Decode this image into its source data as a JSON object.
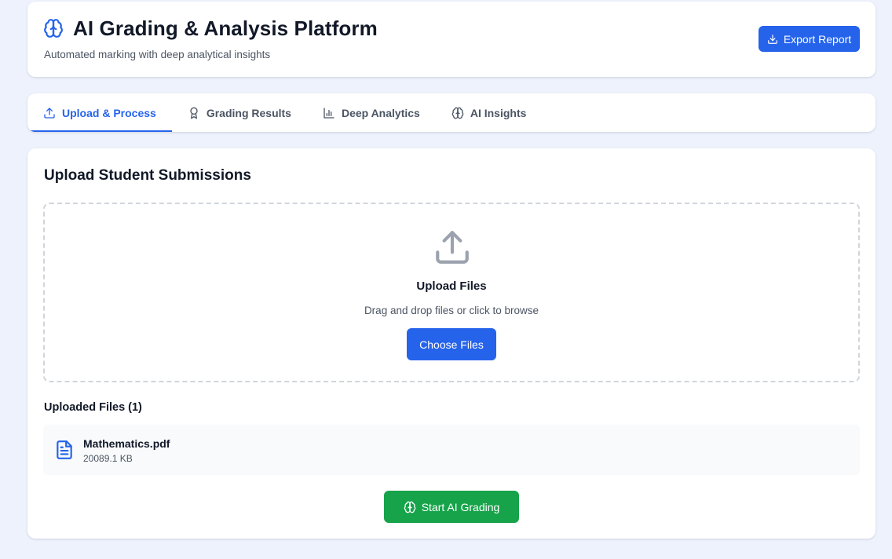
{
  "header": {
    "icon": "brain-icon",
    "title": "AI Grading & Analysis Platform",
    "subtitle": "Automated marking with deep analytical insights",
    "export_label": "Export Report",
    "export_icon": "download-icon"
  },
  "tabs": [
    {
      "label": "Upload & Process",
      "icon": "upload-icon",
      "active": true
    },
    {
      "label": "Grading Results",
      "icon": "award-icon",
      "active": false
    },
    {
      "label": "Deep Analytics",
      "icon": "bar-chart-icon",
      "active": false
    },
    {
      "label": "AI Insights",
      "icon": "brain-icon",
      "active": false
    }
  ],
  "upload": {
    "section_title": "Upload Student Submissions",
    "dropzone_title": "Upload Files",
    "dropzone_hint": "Drag and drop files or click to browse",
    "choose_label": "Choose Files",
    "uploaded_title": "Uploaded Files (1)",
    "files": [
      {
        "name": "Mathematics.pdf",
        "size": "20089.1 KB",
        "icon": "file-text-icon"
      }
    ],
    "start_label": "Start AI Grading"
  },
  "colors": {
    "accent": "#2563eb",
    "success": "#16a34a",
    "background": "#eef2fc"
  }
}
